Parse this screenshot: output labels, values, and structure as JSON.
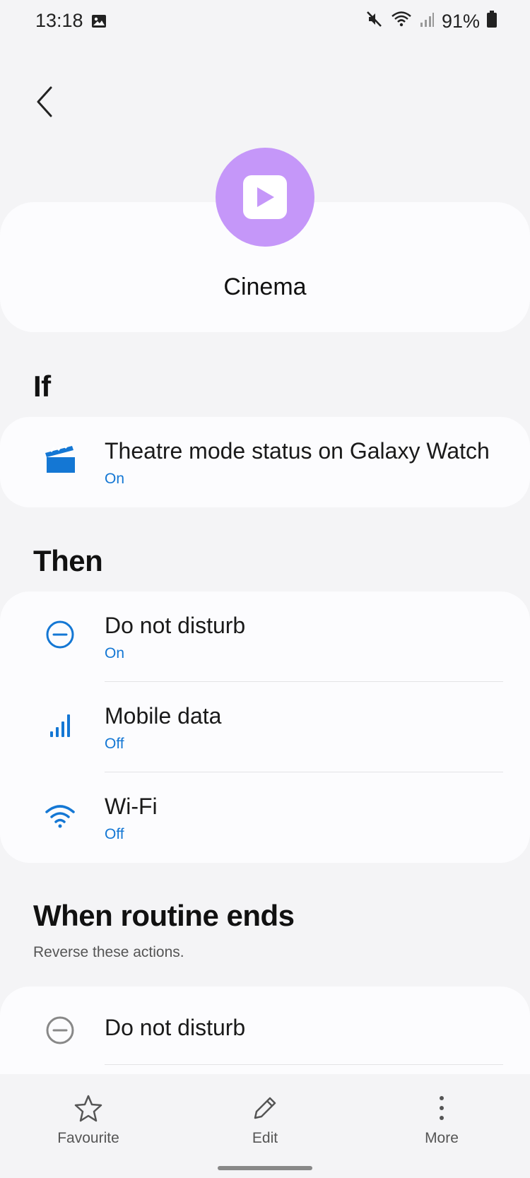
{
  "status_bar": {
    "time": "13:18",
    "battery": "91%",
    "icons": [
      "gallery-icon",
      "mute-icon",
      "wifi-icon",
      "signal-icon",
      "battery-icon"
    ]
  },
  "header": {
    "routine_name": "Cinema",
    "icon": "play-icon",
    "icon_bg_color": "#c597f9"
  },
  "if_section": {
    "title": "If",
    "items": [
      {
        "title": "Theatre mode status on Galaxy Watch",
        "status": "On",
        "icon": "clapperboard-icon"
      }
    ]
  },
  "then_section": {
    "title": "Then",
    "items": [
      {
        "title": "Do not disturb",
        "status": "On",
        "icon": "do-not-disturb-icon"
      },
      {
        "title": "Mobile data",
        "status": "Off",
        "icon": "mobile-data-icon"
      },
      {
        "title": "Wi-Fi",
        "status": "Off",
        "icon": "wifi-icon"
      }
    ]
  },
  "ends_section": {
    "title": "When routine ends",
    "subtitle": "Reverse these actions.",
    "items": [
      {
        "title": "Do not disturb",
        "icon": "do-not-disturb-icon"
      }
    ]
  },
  "bottom_nav": {
    "favourite": "Favourite",
    "edit": "Edit",
    "more": "More"
  },
  "colors": {
    "accent": "#1477d4",
    "background": "#f4f4f6",
    "card": "#fcfcfe"
  }
}
